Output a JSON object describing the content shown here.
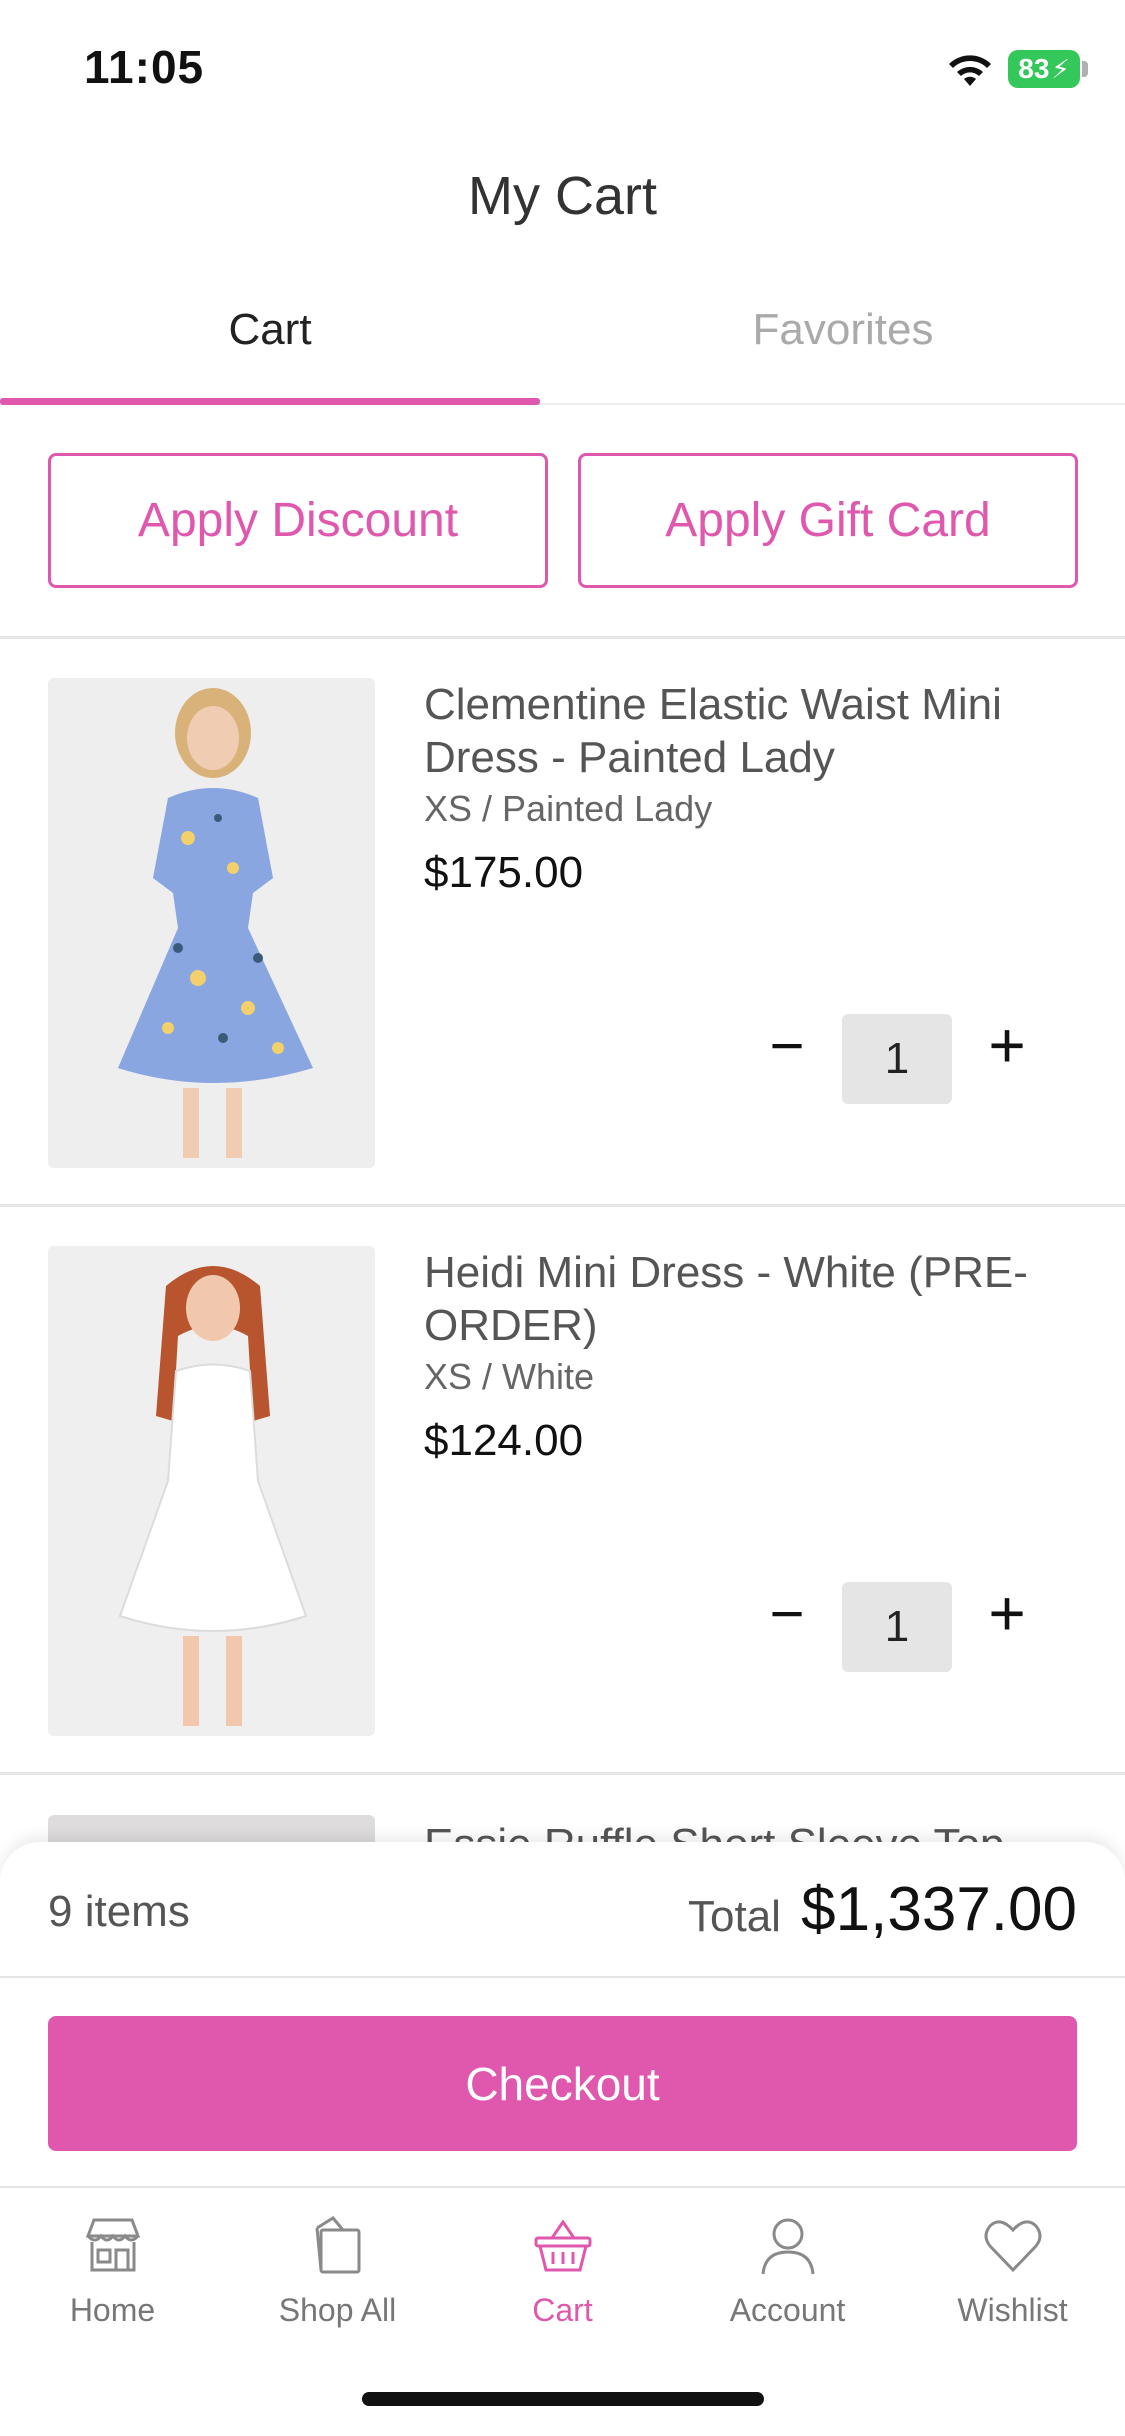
{
  "status_bar": {
    "time": "11:05",
    "battery": "83",
    "icons": [
      "wifi-icon",
      "battery-charging-icon"
    ]
  },
  "header": {
    "title": "My Cart"
  },
  "tabs": [
    {
      "label": "Cart",
      "active": true
    },
    {
      "label": "Favorites",
      "active": false
    }
  ],
  "actions": {
    "discount_label": "Apply Discount",
    "gift_card_label": "Apply Gift Card"
  },
  "items": [
    {
      "name": "Clementine Elastic Waist Mini Dress - Painted Lady",
      "variant": "XS / Painted Lady",
      "price": "$175.00",
      "quantity": "1",
      "minus": "−",
      "plus": "+"
    },
    {
      "name": "Heidi Mini Dress - White (PRE-ORDER)",
      "variant": "XS / White",
      "price": "$124.00",
      "quantity": "1",
      "minus": "−",
      "plus": "+"
    },
    {
      "name": "Essie Ruffle Short Sleeve Top"
    }
  ],
  "summary": {
    "items_count": "9 items",
    "total_label": "Total",
    "total_value": "$1,337.00",
    "checkout_label": "Checkout"
  },
  "nav": [
    {
      "label": "Home",
      "icon": "storefront-icon",
      "active": false
    },
    {
      "label": "Shop All",
      "icon": "shopping-bag-icon",
      "active": false
    },
    {
      "label": "Cart",
      "icon": "basket-icon",
      "active": true
    },
    {
      "label": "Account",
      "icon": "person-icon",
      "active": false
    },
    {
      "label": "Wishlist",
      "icon": "heart-icon",
      "active": false
    }
  ],
  "colors": {
    "accent": "#df58ae",
    "battery": "#34c759",
    "inactive_text": "#777777"
  }
}
